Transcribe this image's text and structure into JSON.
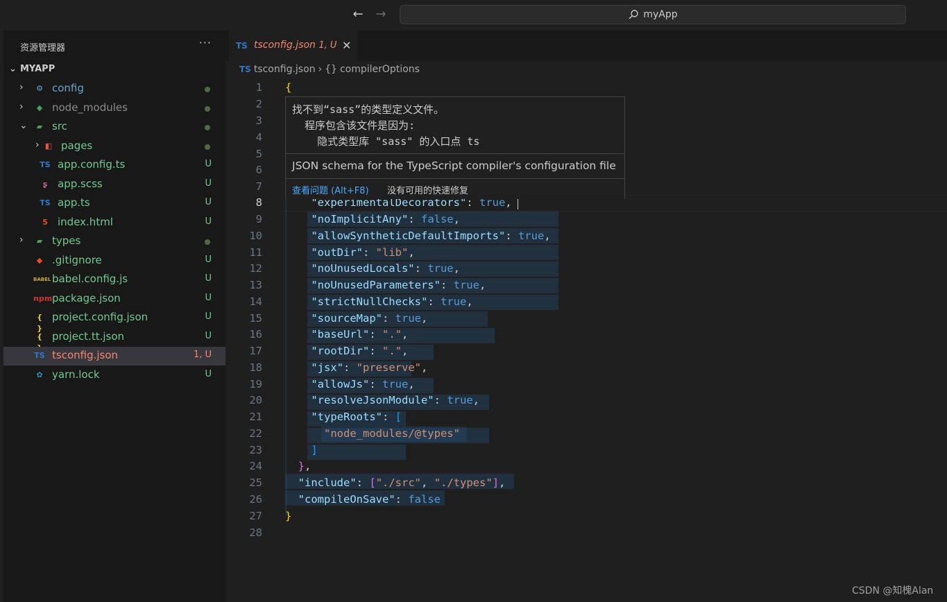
{
  "titlebar": {
    "search_text": "myApp"
  },
  "sidebar": {
    "title": "资源管理器",
    "more": "···",
    "project": "MYAPP",
    "items": [
      {
        "label": "config",
        "status": "dot",
        "color": "#6aa4c7",
        "icon": "folder-config-icon",
        "glyph": "⚙",
        "indent": 0,
        "chevron": "›"
      },
      {
        "label": "node_modules",
        "status": "dot",
        "color": "#8b8b8b",
        "icon": "folder-node-icon",
        "glyph": "◆",
        "indent": 0,
        "chevron": "›"
      },
      {
        "label": "src",
        "status": "dot",
        "color": "#73c991",
        "icon": "folder-src-icon",
        "glyph": "▰",
        "indent": 0,
        "chevron": "⌄"
      },
      {
        "label": "pages",
        "status": "dot",
        "color": "#73c991",
        "icon": "folder-pages-icon",
        "glyph": "◧",
        "indent": 1,
        "chevron": "›"
      },
      {
        "label": "app.config.ts",
        "status": "U",
        "color": "#73c991",
        "icon": "typescript-file-icon",
        "glyph": "TS",
        "indent": 1
      },
      {
        "label": "app.scss",
        "status": "U",
        "color": "#73c991",
        "icon": "sass-file-icon",
        "glyph": "ʂ",
        "indent": 1
      },
      {
        "label": "app.ts",
        "status": "U",
        "color": "#73c991",
        "icon": "typescript-file-icon",
        "glyph": "TS",
        "indent": 1
      },
      {
        "label": "index.html",
        "status": "U",
        "color": "#73c991",
        "icon": "html5-file-icon",
        "glyph": "5",
        "indent": 1
      },
      {
        "label": "types",
        "status": "dot",
        "color": "#73c991",
        "icon": "folder-types-icon",
        "glyph": "▰",
        "indent": 0,
        "chevron": "›"
      },
      {
        "label": ".gitignore",
        "status": "U",
        "color": "#73c991",
        "icon": "git-icon",
        "glyph": "◆",
        "indent": 0
      },
      {
        "label": "babel.config.js",
        "status": "U",
        "color": "#73c991",
        "icon": "babel-icon",
        "glyph": "BABEL",
        "indent": 0
      },
      {
        "label": "package.json",
        "status": "U",
        "color": "#73c991",
        "icon": "npm-icon",
        "glyph": "npm",
        "indent": 0
      },
      {
        "label": "project.config.json",
        "status": "U",
        "color": "#73c991",
        "icon": "json-braces-icon",
        "glyph": "{ }",
        "indent": 0
      },
      {
        "label": "project.tt.json",
        "status": "U",
        "color": "#73c991",
        "icon": "json-braces-icon",
        "glyph": "{ }",
        "indent": 0
      },
      {
        "label": "tsconfig.json",
        "status": "1, U",
        "color": "#f48771",
        "icon": "tsconfig-icon",
        "glyph": "TS",
        "indent": 0,
        "selected": true
      },
      {
        "label": "yarn.lock",
        "status": "U",
        "color": "#73c991",
        "icon": "yarn-icon",
        "glyph": "✿",
        "indent": 0
      }
    ]
  },
  "tab": {
    "name": "tsconfig.json",
    "problems": "1, U",
    "close": "✕",
    "icon": "TS"
  },
  "breadcrumb": {
    "file": "tsconfig.json",
    "sep": "›",
    "symbol_icon": "{}",
    "symbol": "compilerOptions"
  },
  "hover": {
    "line1": "找不到“sass”的类型定义文件。",
    "line2": "  程序包含该文件是因为:",
    "line3": "    隐式类型库 \"sass\" 的入口点 ts",
    "schema": "JSON schema for the TypeScript compiler's configuration file",
    "view_problem": "查看问题 (Alt+F8)",
    "no_fix": "没有可用的快速修复"
  },
  "editor": {
    "current_line": 8,
    "line_numbers": [
      "1",
      "2",
      "3",
      "4",
      "5",
      "6",
      "7",
      "8",
      "9",
      "10",
      "11",
      "12",
      "13",
      "14",
      "15",
      "16",
      "17",
      "18",
      "19",
      "20",
      "21",
      "22",
      "23",
      "24",
      "25",
      "26",
      "27",
      "28"
    ]
  },
  "watermark": "CSDN @知槐Alan"
}
